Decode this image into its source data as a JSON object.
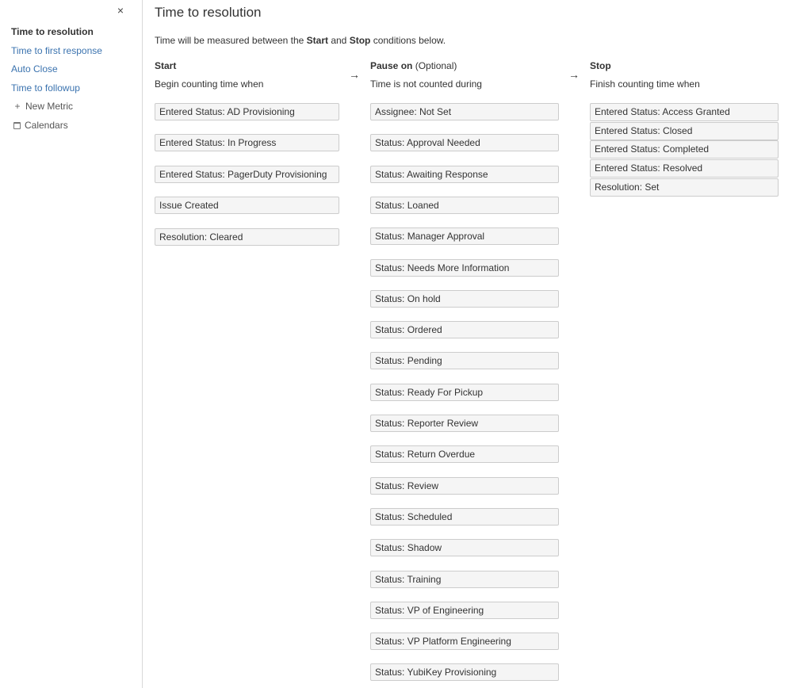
{
  "sidebar": {
    "close_glyph": "×",
    "items": [
      {
        "label": "Time to resolution"
      },
      {
        "label": "Time to first response"
      },
      {
        "label": "Auto Close"
      },
      {
        "label": "Time to followup"
      }
    ],
    "new_metric_icon": "+",
    "new_metric_label": "New Metric",
    "calendars_label": "Calendars"
  },
  "main": {
    "title": "Time to resolution",
    "intro": {
      "prefix": "Time will be measured between the ",
      "start_word": "Start",
      "middle": " and ",
      "stop_word": "Stop",
      "suffix": " conditions below."
    },
    "arrow_glyph": "→",
    "start": {
      "heading": "Start",
      "subheading": "Begin counting time when",
      "conditions": [
        "Entered Status: AD Provisioning",
        "Entered Status: In Progress",
        "Entered Status: PagerDuty Provisioning",
        "Issue Created",
        "Resolution: Cleared"
      ]
    },
    "pause": {
      "heading": "Pause on",
      "optional": " (Optional)",
      "subheading": "Time is not counted during",
      "conditions": [
        "Assignee: Not Set",
        "Status: Approval Needed",
        "Status: Awaiting Response",
        "Status: Loaned",
        "Status: Manager Approval",
        "Status: Needs More Information",
        "Status: On hold",
        "Status: Ordered",
        "Status: Pending",
        "Status: Ready For Pickup",
        "Status: Reporter Review",
        "Status: Return Overdue",
        "Status: Review",
        "Status: Scheduled",
        "Status: Shadow",
        "Status: Training",
        "Status: VP of Engineering",
        "Status: VP Platform Engineering",
        "Status: YubiKey Provisioning"
      ]
    },
    "stop": {
      "heading": "Stop",
      "subheading": "Finish counting time when",
      "conditions": [
        "Entered Status: Access Granted",
        "Entered Status: Closed",
        "Entered Status: Completed",
        "Entered Status: Resolved",
        "Resolution: Set"
      ]
    }
  }
}
